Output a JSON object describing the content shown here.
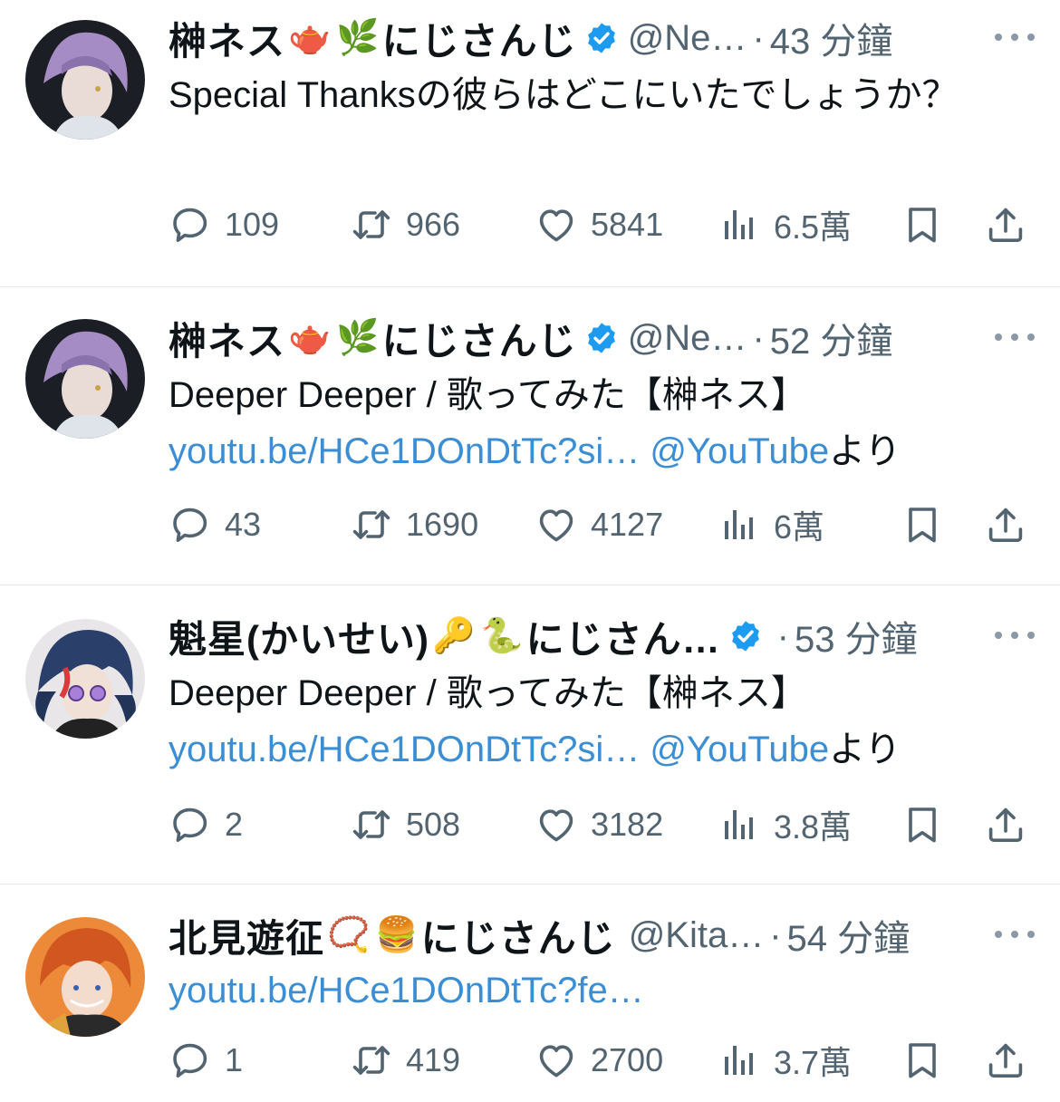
{
  "tweets": [
    {
      "name": "榊ネス",
      "emojis": [
        "🫖",
        "🌿"
      ],
      "name_suffix": "にじさんじ",
      "verified": true,
      "handle": "@Ne…",
      "separator": "·",
      "time": "43 分鐘",
      "text": "Special Thanksの彼らはどこにいたでしょうか？",
      "link": "",
      "link_suffix": "",
      "replies": "109",
      "retweets": "966",
      "likes": "5841",
      "views": "6.5萬"
    },
    {
      "name": "榊ネス",
      "emojis": [
        "🫖",
        "🌿"
      ],
      "name_suffix": "にじさんじ",
      "verified": true,
      "handle": "@Ne…",
      "separator": "·",
      "time": "52 分鐘",
      "text": "Deeper Deeper / 歌ってみた【榊ネス】",
      "link": "youtu.be/HCe1DOnDtTc?si… @YouTube",
      "link_suffix": "より",
      "replies": "43",
      "retweets": "1690",
      "likes": "4127",
      "views": "6萬"
    },
    {
      "name": "魁星(かいせい)",
      "emojis": [
        "🔑",
        "🐍"
      ],
      "name_suffix": "にじさん…",
      "verified": true,
      "handle": "",
      "separator": "·",
      "time": "53 分鐘",
      "text": "Deeper Deeper / 歌ってみた【榊ネス】",
      "link": "youtu.be/HCe1DOnDtTc?si… @YouTube",
      "link_suffix": "より",
      "replies": "2",
      "retweets": "508",
      "likes": "3182",
      "views": "3.8萬"
    },
    {
      "name": "北見遊征",
      "emojis": [
        "📿",
        "🍔"
      ],
      "name_suffix": "にじさんじ",
      "verified": false,
      "handle": "@Kita…",
      "separator": "·",
      "time": "54 分鐘",
      "text": "",
      "link": "youtu.be/HCe1DOnDtTc?fe…",
      "link_suffix": "",
      "replies": "1",
      "retweets": "419",
      "likes": "2700",
      "views": "3.7萬"
    }
  ],
  "colors": {
    "text": "#0f1419",
    "secondary": "#536471",
    "link": "#3b8ed3",
    "verified": "#1d9bf0",
    "divider": "#e6e9ec"
  },
  "icons": [
    "reply-icon",
    "retweet-icon",
    "like-icon",
    "views-icon",
    "bookmark-icon",
    "share-icon",
    "more-icon",
    "verified-badge-icon"
  ]
}
